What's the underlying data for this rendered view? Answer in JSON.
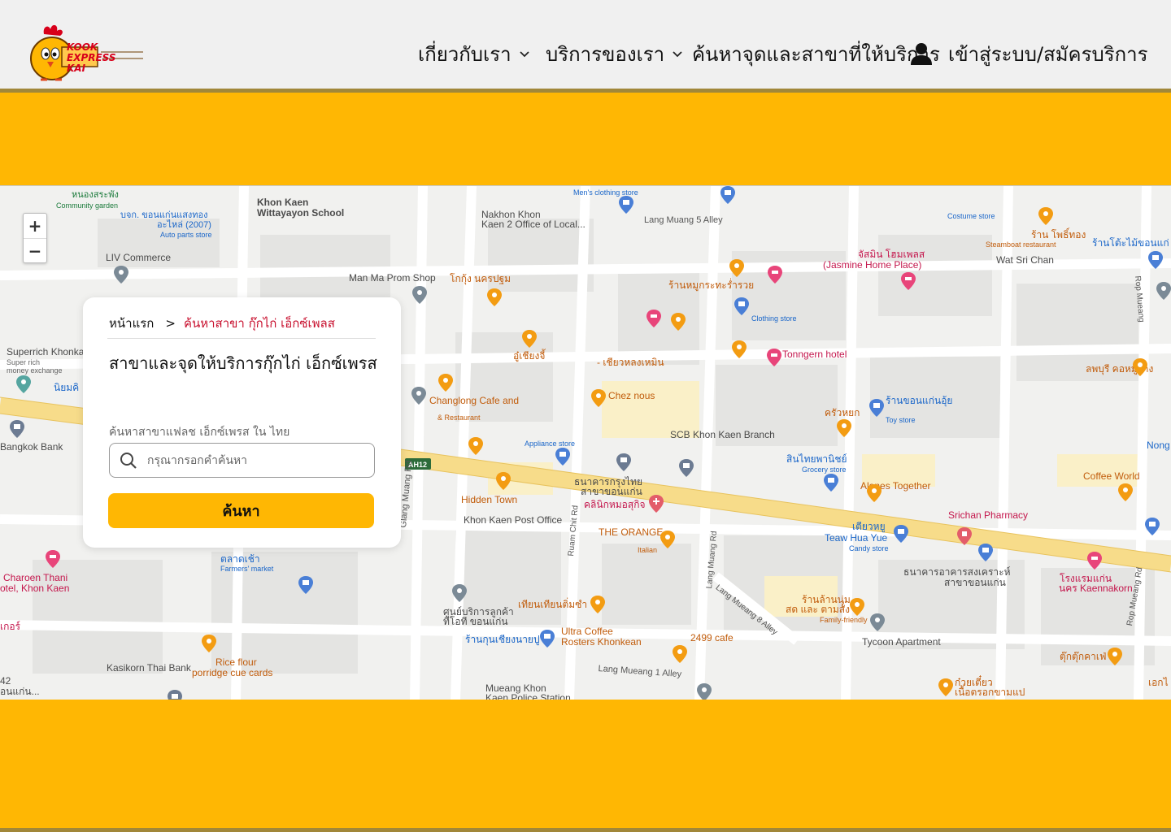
{
  "brand": {
    "logo_line1": "KOOK EXPRESS",
    "logo_line2": "KAI"
  },
  "nav": {
    "about": "เกี่ยวกับเรา",
    "services": "บริการของเรา",
    "find_branch": "ค้นหาจุดและสาขาที่ให้บริการ",
    "login": "เข้าสู่ระบบ/สมัครบริการ"
  },
  "card": {
    "breadcrumb_home": "หน้าแรก",
    "breadcrumb_sep": ">",
    "breadcrumb_current": "ค้นหาสาขา กุ๊กไก่ เอ็กซ์เพลส",
    "title": "สาขาและจุดให้บริการกุ๊กไก่ เอ็กซ์เพรส",
    "search_label": "ค้นหาสาขาแฟลช เอ็กซ์เพรส ใน ไทย",
    "search_placeholder": "กรุณากรอกคำค้นหา",
    "search_value": "",
    "search_button": "ค้นหา"
  },
  "map": {
    "zoom_in": "+",
    "zoom_out": "−",
    "labels": {
      "khon_kaen_school": "Khon Kaen",
      "khon_kaen_school2": "Wittayayon School",
      "nakhon_khon": "Nakhon Khon",
      "nakhon_khon2": "Kaen 2 Office of Local...",
      "lang_muang_5": "Lang Muang 5 Alley",
      "mens_clothing": "Men's clothing store",
      "costume_store": "Costume store",
      "steamboat": "Steamboat restaurant",
      "wat_sri_chan": "Wat Sri Chan",
      "liv_commerce": "LIV Commerce",
      "man_ma_prom": "Man Ma Prom Shop",
      "jasmine_home": "(Jasmine Home Place)",
      "clothing_store": "Clothing store",
      "superrich": "Superrich Khonka",
      "superrich_sub": "Super rich",
      "money_exchange": "money exchange",
      "tonngern": "Tonngern hotel",
      "changlong": "Changlong Cafe and",
      "changlong_sub": "& Restaurant",
      "chez_nous": "Chez nous",
      "toy_store": "Toy store",
      "scb": "SCB Khon Kaen Branch",
      "appliance_store": "Appliance store",
      "grocery_store": "Grocery store",
      "bangkok_bank": "Bangkok Bank",
      "nong": "Nong",
      "coffee_world": "Coffee World",
      "ah12": "AH12",
      "hidden_town": "Hidden Town",
      "alones": "Alones Together",
      "srichan": "Srichan Pharmacy",
      "khon_kaen_post": "Khon Kaen Post Office",
      "the_orange": "THE ORANGE",
      "italian": "Italian",
      "teaw_hua_yue": "Teaw Hua Yue",
      "candy_store": "Candy store",
      "glang_muang": "Glang Muang Rd",
      "ruam_chit": "Ruam Chit Rd",
      "lang_muang_rd": "Lang Muang Rd",
      "lang_muang_8": "Lang Mueang 8 Alley",
      "rop_mueang": "Rop Mueang",
      "rop_mueang_rd": "Rop Mueang Rd",
      "charoen_thani": "Charoen Thani",
      "hotel_khon_kaen": "otel, Khon Kaen",
      "farmers_market": "Farmers' market",
      "family_friendly": "Family-friendly",
      "tycoon": "Tycoon Apartment",
      "kaennakorn": "นคร Kaennakorn",
      "ultra_coffee": "Ultra Coffee",
      "ultra_coffee2": "Rosters Khonkean",
      "cafe_2499": "2499 cafe",
      "rice_flour": "Rice flour",
      "porridge": "porridge cue cards",
      "kasikorn": "Kasikorn Thai Bank",
      "lang_mueang_1": "Lang Mueang 1 Alley",
      "mueang_khon": "Mueang Khon",
      "police_station": "Kaen Police Station",
      "community_garden": "Community garden",
      "auto_parts": "Auto parts store",
      "th_nong_sra": "หนองสระพัง",
      "th_auto": "บจก. ขอนแก่นแสงทอง",
      "th_auto2": "อะไหล่ (2007)",
      "th_kookkung": "โกกุ้ง นครปฐม",
      "th_mookrata": "ร้านหมูกระทะร่ำรวย",
      "th_jasmine": "จัสมิน โฮมเพลส",
      "th_phochi": "ร้าน โพธิ์ทอง",
      "th_rantoh": "ร้านโต้ะไม้ขอนแก่",
      "th_u_chiang": "อู๋เชียงจี้",
      "th_chiao": "- เชียวหลงเหมิน",
      "th_lopburi": "ลพบุรี คอหมูย่าง",
      "th_krua": "ครัวหยก",
      "th_khonkaen_ui": "ร้านขอนแก่นอุ้ย",
      "th_sinthai": "สินไทยพานิชย์",
      "th_krungthai": "ธนาคารกรุงไทย",
      "th_krungthai2": "สาขาขอนแก่น",
      "th_clinic": "คลินิกหมอสุกิจ",
      "th_talad": "ตลาดเช้า",
      "th_tiao": "เตียวหยู",
      "th_thanakarn": "ธนาคารอาคารสงเคราะห์",
      "th_thanakarn2": "สาขาขอนแก่น",
      "th_ranlan": "ร้านล้านนุ่ม",
      "th_sod": "สด และ ตามสั่ง",
      "th_service": "ศูนย์บริการลูกค้า",
      "th_service2": "ทีโอที ขอนแก่น",
      "th_kuay": "ร้านกุนเชียงนายปู",
      "th_tian": "เทียนเทียนติ่มซำ",
      "th_tuk": "ตุ๊กตุ๊กคาเฟ่",
      "th_kuaytiao": "ก๋วยเตี๋ยว",
      "th_kuaytiao2": "เนื้อตรอกขามแป",
      "th_ekkai": "เอกไ",
      "th_ron": "โรงแรมแก่น",
      "th_niyom": "นิยมคิ",
      "th_kaer": "เกอร์",
      "th_42": "42",
      "th_kaen": "อนแก่น..."
    }
  },
  "colors": {
    "brand_yellow": "#ffb703",
    "accent_red": "#c8102e",
    "header_bg": "#f0f0f0",
    "header_border": "#a18739"
  }
}
